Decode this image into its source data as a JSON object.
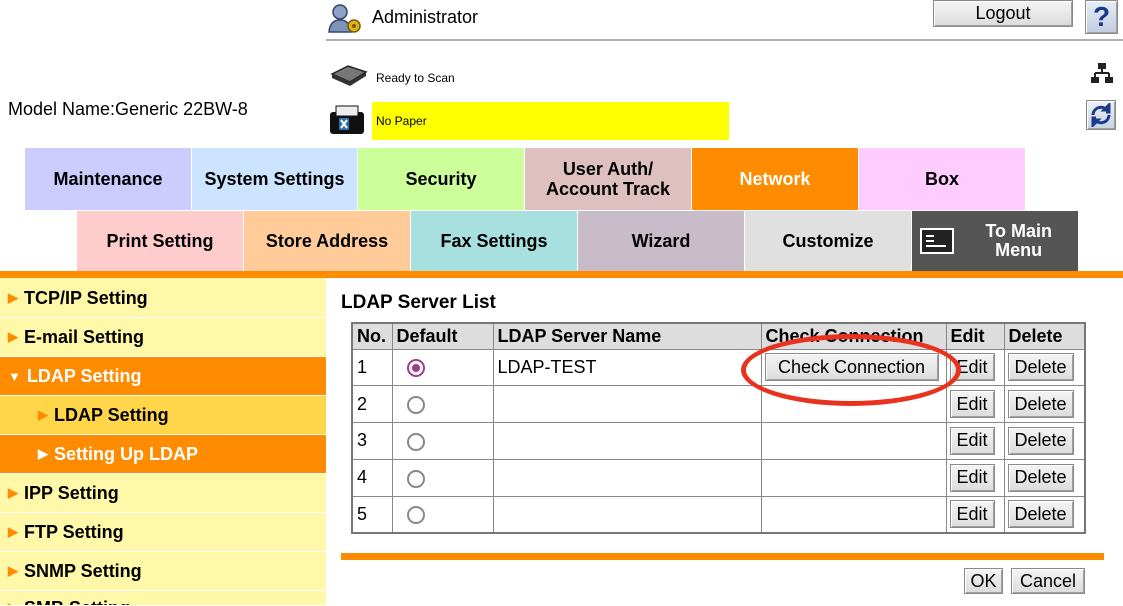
{
  "header": {
    "user": "Administrator",
    "logout_label": "Logout",
    "help_label": "?",
    "model_name": "Model Name:Generic 22BW-8",
    "status_scan": "Ready to Scan",
    "status_paper": "No Paper"
  },
  "colors": {
    "accent_orange": "#ff8c00",
    "sidebar_yellow": "#fff8a8",
    "paper_warning": "#ffff00",
    "annotation_red": "#e8321e"
  },
  "main_tabs": [
    {
      "label": "Maintenance",
      "color": "#ccccff"
    },
    {
      "label": "System Settings",
      "color": "#cce4ff"
    },
    {
      "label": "Security",
      "color": "#ccff99"
    },
    {
      "label": "User Auth/\nAccount Track",
      "color": "#dfc0c0"
    },
    {
      "label": "Network",
      "color": "#ff8c00",
      "active": true
    },
    {
      "label": "Box",
      "color": "#ffccff"
    }
  ],
  "sub_tabs": [
    {
      "label": "Print Setting",
      "color": "#ffcccc"
    },
    {
      "label": "Store Address",
      "color": "#ffcc99"
    },
    {
      "label": "Fax Settings",
      "color": "#a8e0e0"
    },
    {
      "label": "Wizard",
      "color": "#c8bcc8"
    },
    {
      "label": "Customize",
      "color": "#e0e0e0"
    },
    {
      "label": "To Main\nMenu",
      "color": "#555555"
    }
  ],
  "sidebar": {
    "items": [
      {
        "label": "TCP/IP Setting"
      },
      {
        "label": "E-mail Setting"
      },
      {
        "label": "LDAP Setting"
      },
      {
        "label": "LDAP Setting"
      },
      {
        "label": "Setting Up LDAP"
      },
      {
        "label": "IPP Setting"
      },
      {
        "label": "FTP Setting"
      },
      {
        "label": "SNMP Setting"
      },
      {
        "label": "SMB Setting"
      }
    ]
  },
  "main": {
    "title": "LDAP Server List",
    "columns": [
      "No.",
      "Default",
      "LDAP Server Name",
      "Check Connection",
      "Edit",
      "Delete"
    ],
    "rows": [
      {
        "no": "1",
        "default": true,
        "name": "LDAP-TEST",
        "check": "Check Connection",
        "edit": "Edit",
        "delete": "Delete"
      },
      {
        "no": "2",
        "default": false,
        "name": "",
        "check": "",
        "edit": "Edit",
        "delete": "Delete"
      },
      {
        "no": "3",
        "default": false,
        "name": "",
        "check": "",
        "edit": "Edit",
        "delete": "Delete"
      },
      {
        "no": "4",
        "default": false,
        "name": "",
        "check": "",
        "edit": "Edit",
        "delete": "Delete"
      },
      {
        "no": "5",
        "default": false,
        "name": "",
        "check": "",
        "edit": "Edit",
        "delete": "Delete"
      }
    ],
    "ok_label": "OK",
    "cancel_label": "Cancel"
  }
}
